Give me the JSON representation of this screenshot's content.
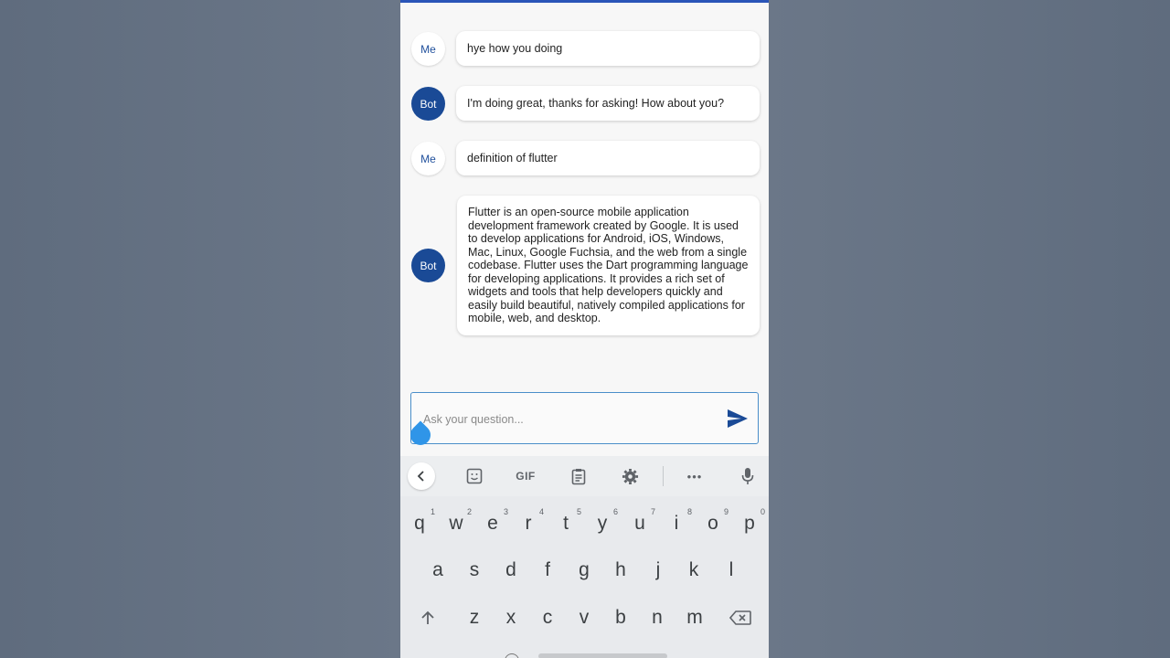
{
  "chat": {
    "messages": [
      {
        "sender": "Me",
        "text": "hye how you doing"
      },
      {
        "sender": "Bot",
        "text": "I'm doing great, thanks for asking! How about you?"
      },
      {
        "sender": "Me",
        "text": "definition of flutter"
      },
      {
        "sender": "Bot",
        "text": "Flutter is an open-source mobile application development framework created by Google. It is used to develop applications for Android, iOS, Windows, Mac, Linux, Google Fuchsia, and the web from a single codebase. Flutter uses the Dart programming language for developing applications. It provides a rich set of widgets and tools that help developers quickly and easily build beautiful, natively compiled applications for mobile, web, and desktop."
      }
    ]
  },
  "input": {
    "placeholder": "Ask your question...",
    "value": ""
  },
  "keyboard": {
    "toolbar": {
      "gif_label": "GIF",
      "more_label": "•••"
    },
    "row1": [
      {
        "k": "q",
        "n": "1"
      },
      {
        "k": "w",
        "n": "2"
      },
      {
        "k": "e",
        "n": "3"
      },
      {
        "k": "r",
        "n": "4"
      },
      {
        "k": "t",
        "n": "5"
      },
      {
        "k": "y",
        "n": "6"
      },
      {
        "k": "u",
        "n": "7"
      },
      {
        "k": "i",
        "n": "8"
      },
      {
        "k": "o",
        "n": "9"
      },
      {
        "k": "p",
        "n": "0"
      }
    ],
    "row2": [
      "a",
      "s",
      "d",
      "f",
      "g",
      "h",
      "j",
      "k",
      "l"
    ],
    "row3": [
      "z",
      "x",
      "c",
      "v",
      "b",
      "n",
      "m"
    ]
  },
  "colors": {
    "accent": "#1a4a96",
    "input_border": "#4a8ec9",
    "cursor_handle": "#2f95e8"
  }
}
